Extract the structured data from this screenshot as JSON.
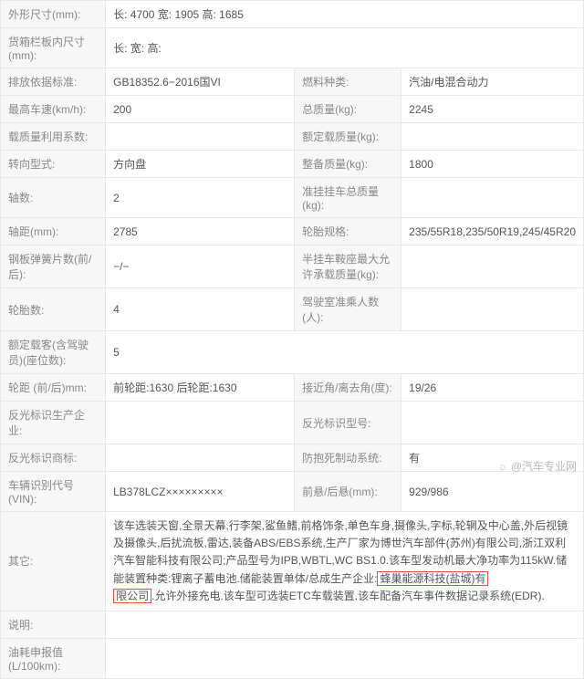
{
  "rows": {
    "dim_label": "外形尺寸(mm):",
    "dim_val": "长: 4700 宽: 1905 高: 1685",
    "cargo_label": "货箱栏板内尺寸(mm):",
    "cargo_val": "长: 宽: 高:",
    "emission_label": "排放依据标准:",
    "emission_val": "GB18352.6−2016国VI",
    "fuel_label": "燃料种类:",
    "fuel_val": "汽油/电混合动力",
    "topspeed_label": "最高车速(km/h):",
    "topspeed_val": "200",
    "totalmass_label": "总质量(kg):",
    "totalmass_val": "2245",
    "loadfactor_label": "载质量利用系数:",
    "loadfactor_val": "",
    "ratedmass_label": "额定载质量(kg):",
    "ratedmass_val": "",
    "steer_label": "转向型式:",
    "steer_val": "方向盘",
    "curbmass_label": "整备质量(kg):",
    "curbmass_val": "1800",
    "axles_label": "轴数:",
    "axles_val": "2",
    "trailermass_label": "准挂挂车总质量(kg):",
    "trailermass_val": "",
    "wheelbase_label": "轴距(mm):",
    "wheelbase_val": "2785",
    "tirespec_label": "轮胎规格:",
    "tirespec_val": "235/55R18,235/50R19,245/45R20",
    "spring_label": "钢板弹簧片数(前/后):",
    "spring_val": "−/−",
    "saddle_label": "半挂车鞍座最大允许承载质量(kg):",
    "saddle_val": "",
    "tirecount_label": "轮胎数:",
    "tirecount_val": "4",
    "cabpass_label": "驾驶室准乘人数(人):",
    "cabpass_val": "",
    "ratedpass_label": "额定载客(含驾驶员)(座位数):",
    "ratedpass_val": "5",
    "track_label": "轮距 (前/后)mm:",
    "track_val": "前轮距:1630 后轮距:1630",
    "angles_label": "接近角/离去角(度):",
    "angles_val": "19/26",
    "reflmfr_label": "反光标识生产企业:",
    "reflmfr_val": "",
    "reflmodel_label": "反光标识型号:",
    "reflmodel_val": "",
    "refltm_label": "反光标识商标:",
    "refltm_val": "",
    "abs_label": "防抱死制动系统:",
    "abs_val": "有",
    "vin_label": "车辆识别代号(VIN):",
    "vin_val": "LB378LCZ×××××××××",
    "overhang_label": "前悬/后悬(mm):",
    "overhang_val": "929/986",
    "other_label": "其它:",
    "other_val_a": "该车选装天窗,全景天幕,行李架,鲨鱼鳍,前格饰条,单色车身,摄像头,字标,轮辋及中心盖,外后视镜及摄像头,后扰流板,雷达,装备ABS/EBS系统,生产厂家为博世汽车部件(苏州)有限公司,浙江双利汽车智能科技有限公司;产品型号为IPB,WBTL,WC BS1.0.该车型发动机最大净功率为115kW.储能装置种类:锂离子蓄电池.储能装置单体/总成生产企业:",
    "other_hl1": "蜂巢能源科技(盐城)有",
    "other_hl2": "限公司",
    "other_val_b": ".允许外接充电.该车型可选装ETC车载装置.该车配备汽车事件数据记录系统(EDR).",
    "note_label": "说明:",
    "note_val": "",
    "fuelcons_label": "油耗申报值(L/100km):",
    "fuelcons_val": ""
  },
  "watermark": "☼ @汽车专业网"
}
